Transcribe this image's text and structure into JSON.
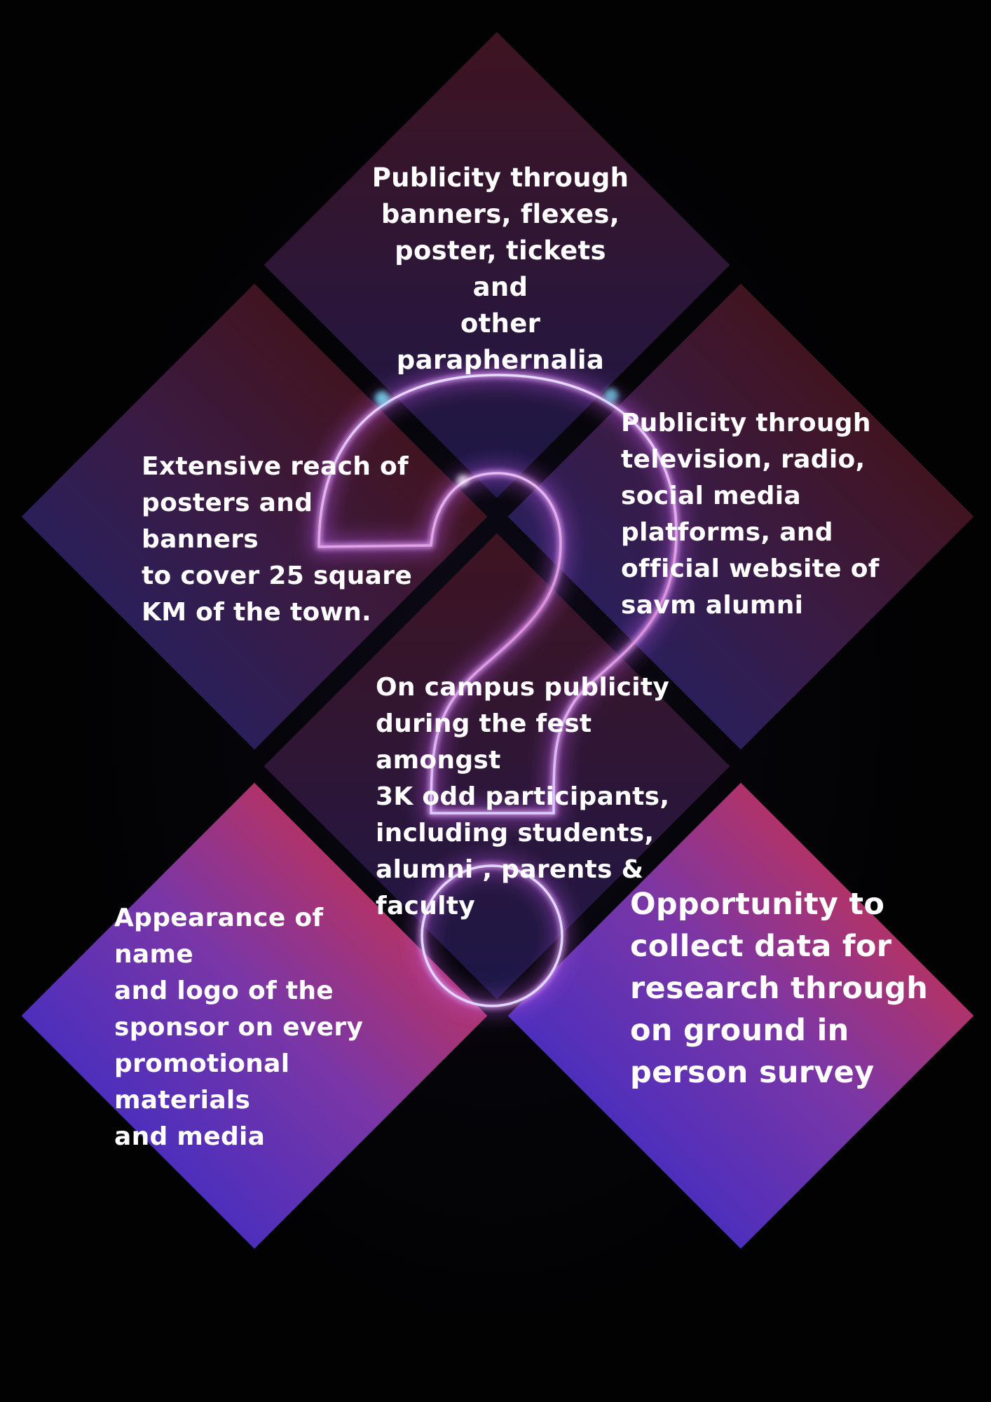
{
  "tiles": {
    "top": {
      "text": "Publicity through\nbanners, flexes,\nposter, tickets and\nother\nparaphernalia"
    },
    "left": {
      "text": "Extensive reach  of\nposters and banners\nto cover 25 square\nKM of the town."
    },
    "right": {
      "text": "Publicity through\ntelevision, radio,\nsocial media\nplatforms, and\nofficial website of\nsavm alumni"
    },
    "center": {
      "text": "On campus publicity\nduring the fest amongst\n3K odd participants,\nincluding students,\nalumni , parents &\nfaculty"
    },
    "bottom_left": {
      "text": "Appearance of name\nand logo of the\nsponsor on every\npromotional materials\nand media"
    },
    "bottom_right": {
      "text": "Opportunity to\ncollect data for\nresearch through\non ground in\nperson survey"
    }
  },
  "graphic": {
    "icon": "question-mark-icon",
    "neon_color": "#d7c8ff",
    "glow_color": "#b44fe0",
    "accent_color": "#7be7ff"
  },
  "colors": {
    "background": "#020203",
    "tile_dark_top": "#3e1420",
    "tile_dark_bottom": "#2b1f5a",
    "tile_bright_top": "#b0336a",
    "tile_bright_bottom": "#4d2fbc",
    "text": "#ffffff"
  }
}
